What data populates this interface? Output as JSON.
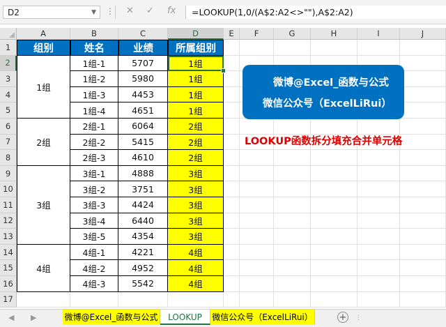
{
  "formula_bar": {
    "name_box": "D2",
    "formula": "=LOOKUP(1,0/(A$2:A2<>\"\"),A$2:A2)",
    "fx_label": "fx",
    "cancel_glyph": "✕",
    "enter_glyph": "✓"
  },
  "columns": [
    "A",
    "B",
    "C",
    "D",
    "E",
    "F",
    "G",
    "H",
    "I",
    "J"
  ],
  "rows": [
    "1",
    "2",
    "3",
    "4",
    "5",
    "6",
    "7",
    "8",
    "9",
    "10",
    "11",
    "12",
    "13",
    "14",
    "15",
    "16",
    "17"
  ],
  "table": {
    "headers": [
      "组别",
      "姓名",
      "业绩",
      "所属组别"
    ],
    "groups": [
      "1组",
      "2组",
      "3组",
      "4组"
    ],
    "names": [
      "1组-1",
      "1组-2",
      "1组-3",
      "1组-4",
      "2组-1",
      "2组-2",
      "2组-3",
      "3组-1",
      "3组-2",
      "3组-3",
      "3组-4",
      "3组-5",
      "4组-1",
      "4组-2",
      "4组-3"
    ],
    "scores": [
      "5707",
      "5980",
      "4453",
      "4651",
      "6064",
      "5415",
      "4610",
      "4888",
      "3751",
      "4424",
      "6440",
      "4354",
      "4221",
      "4952",
      "5542"
    ],
    "assigned": [
      "1组",
      "1组",
      "1组",
      "1组",
      "2组",
      "2组",
      "2组",
      "3组",
      "3组",
      "3组",
      "3组",
      "3组",
      "4组",
      "4组",
      "4组"
    ]
  },
  "callout": {
    "line1": "微博@Excel_函数与公式",
    "line2": "微信公众号（ExcelLiRui）"
  },
  "red_title": "LOOKUP函数拆分填充合并单元格",
  "sheet_tabs": [
    "微博@Excel_函数与公式",
    "LOOKUP",
    "微信公众号（ExcelLiRui）"
  ],
  "colors": {
    "header_blue": "#0070c0",
    "highlight_yellow": "#ffff00",
    "excel_green": "#217346",
    "red_text": "#e00000"
  }
}
